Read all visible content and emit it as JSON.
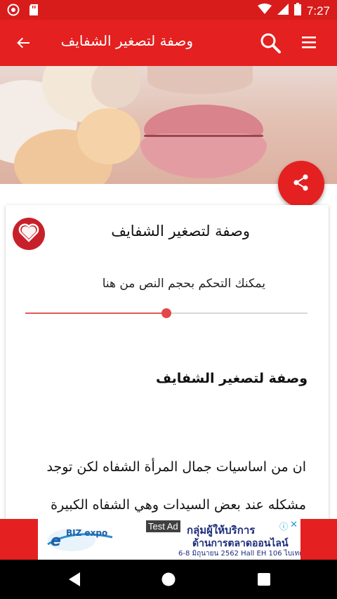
{
  "status_bar": {
    "time": "7:27",
    "left_icons": [
      "sync-icon",
      "sd-card-icon"
    ],
    "right_icons": [
      "wifi-icon",
      "signal-icon",
      "battery-icon"
    ]
  },
  "app_bar": {
    "title": "وصفة لتصغير الشفايف",
    "back_icon": "arrow-back-icon",
    "search_icon": "search-icon",
    "menu_icon": "menu-icon"
  },
  "hero": {
    "image_semantic": "lips-photo"
  },
  "share_button": {
    "icon": "share-icon"
  },
  "card": {
    "title": "وصفة لتصغير الشفايف",
    "favorite_icon": "heart-icon",
    "font_size_label": "يمكنك التحكم بحجم النص من هنا",
    "font_size_value": 0.5,
    "content_heading": "وصفة لتصغير الشفايف",
    "content_lines": [
      "ان من اساسيات جمال المرأة الشفاه لكن توجد",
      "مشكله عند بعض السيدات وهي الشفاه الكبيرة"
    ]
  },
  "ad": {
    "logo_text": "BIZ expo",
    "tag": "Test Ad",
    "headline": "กลุ่มผู้ให้บริการ",
    "subline": "ด้านการตลาดออนไลน์",
    "date": "6-8 มิถุนายน 2562  Hall EH 106 ไบเทค",
    "info_icon": "info-icon",
    "close_icon": "close-icon"
  },
  "nav_bar": {
    "icons": [
      "back-triangle-icon",
      "home-circle-icon",
      "recents-square-icon"
    ]
  },
  "colors": {
    "primary": "#e42020",
    "status": "#d81b1b",
    "slider": "#e24848"
  }
}
